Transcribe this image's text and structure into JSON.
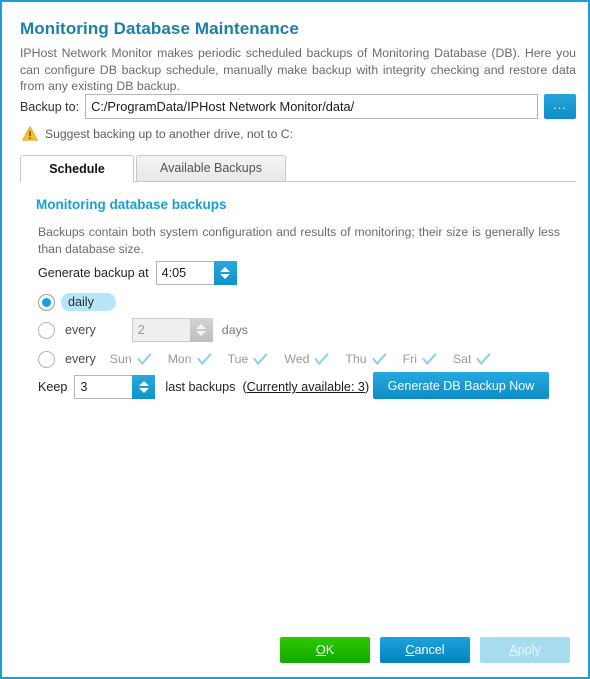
{
  "window": {
    "border_color": "#1b9fd8"
  },
  "header": {
    "title": "Monitoring Database Maintenance",
    "intro": "IPHost Network Monitor makes periodic scheduled backups of Monitoring Database (DB). Here you can configure DB backup schedule, manually make backup with integrity checking and restore data from any existing DB backup."
  },
  "backup_path": {
    "label": "Backup to:",
    "value": "C:/ProgramData/IPHost Network Monitor/data/",
    "placeholder": "C:/ProgramData/IPHost Network Monitor/data/",
    "browse_label": "...",
    "warning": "Suggest backing up to another drive, not to C:",
    "warning_color": "#f5bc22"
  },
  "tabs": [
    {
      "label": "Schedule",
      "active": true
    },
    {
      "label": "Available Backups",
      "active": false
    }
  ],
  "schedule": {
    "section_title": "Monitoring database backups",
    "section_desc": "Backups contain both system configuration and results of monitoring; their size is generally less than database size.",
    "generate_at": {
      "label": "Generate backup at",
      "value": "4:05"
    },
    "options": [
      {
        "id": "daily",
        "label": "daily",
        "selected": true
      },
      {
        "id": "every-n-days",
        "label": "every",
        "selected": false
      },
      {
        "id": "every-weekday",
        "label": "every",
        "selected": false
      }
    ],
    "interval": {
      "value": "2",
      "unit_label": "days",
      "disabled": true
    },
    "weekdays": [
      {
        "name": "Sun",
        "checked": true
      },
      {
        "name": "Mon",
        "checked": true
      },
      {
        "name": "Tue",
        "checked": true
      },
      {
        "name": "Wed",
        "checked": true
      },
      {
        "name": "Thu",
        "checked": true
      },
      {
        "name": "Fri",
        "checked": true
      },
      {
        "name": "Sat",
        "checked": true
      }
    ],
    "keep": {
      "label": "Keep",
      "value": "3",
      "after_label": "last backups",
      "available_prefix": "(",
      "available_link": "Currently available: 3",
      "available_suffix": ")"
    },
    "generate_now_label": "Generate DB Backup Now"
  },
  "footer": {
    "ok": {
      "accel": "O",
      "rest": "K"
    },
    "cancel": {
      "accel": "C",
      "rest": "ancel"
    },
    "apply": {
      "accel": "A",
      "rest": "pply"
    }
  },
  "colors": {
    "title": "#1c7fa8",
    "section_title": "#1a9fd4",
    "accent_blue": "#1b9fd8",
    "ok_green": "#1fb802",
    "selected_pill": "#b5e5f7"
  }
}
